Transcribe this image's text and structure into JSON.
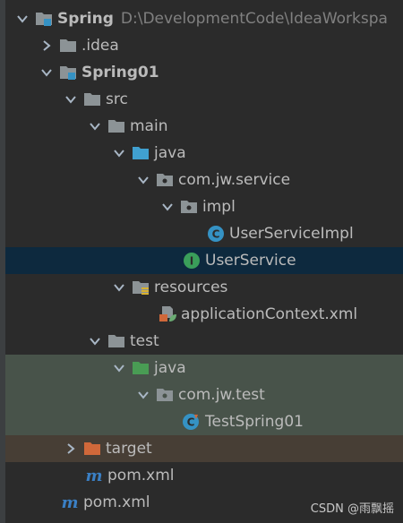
{
  "tree": {
    "root": {
      "label": "Spring",
      "path": "D:\\DevelopmentCode\\IdeaWorkspa",
      "icon": "module-folder-icon"
    },
    "idea": {
      "label": ".idea",
      "icon": "folder-icon"
    },
    "spring01": {
      "label": "Spring01",
      "icon": "module-folder-icon"
    },
    "src": {
      "label": "src",
      "icon": "folder-icon"
    },
    "main": {
      "label": "main",
      "icon": "folder-icon"
    },
    "main_java": {
      "label": "java",
      "icon": "source-root-folder-icon"
    },
    "pkg_service": {
      "label": "com.jw.service",
      "icon": "package-icon"
    },
    "pkg_impl": {
      "label": "impl",
      "icon": "package-icon"
    },
    "user_service_impl": {
      "label": "UserServiceImpl",
      "icon": "class-icon"
    },
    "user_service": {
      "label": "UserService",
      "icon": "interface-icon"
    },
    "resources": {
      "label": "resources",
      "icon": "resources-folder-icon"
    },
    "app_context": {
      "label": "applicationContext.xml",
      "icon": "spring-xml-icon"
    },
    "test": {
      "label": "test",
      "icon": "folder-icon"
    },
    "test_java": {
      "label": "java",
      "icon": "test-source-folder-icon"
    },
    "pkg_test": {
      "label": "com.jw.test",
      "icon": "package-icon"
    },
    "test_spring": {
      "label": "TestSpring01",
      "icon": "test-class-icon"
    },
    "target": {
      "label": "target",
      "icon": "excluded-folder-icon"
    },
    "pom_inner": {
      "label": "pom.xml",
      "icon": "maven-icon"
    },
    "pom_outer": {
      "label": "pom.xml",
      "icon": "maven-icon"
    }
  },
  "watermark": "CSDN @雨飘摇",
  "colors": {
    "background": "#2b2b2b",
    "selected_row": "#0d293e",
    "test_row": "#48534a",
    "excluded_row": "#473e35",
    "folder": "#8c9396",
    "source_folder": "#40a0d0",
    "test_folder": "#499c54",
    "excluded_folder": "#d0683a",
    "class_icon": "#3592c4",
    "interface_icon": "#3a9e5a"
  }
}
